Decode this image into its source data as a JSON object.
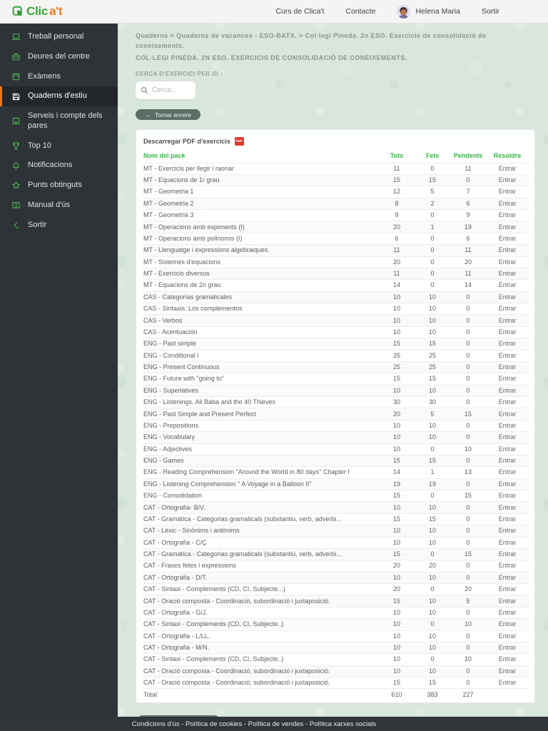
{
  "colors": {
    "accent_green": "#3cb54a",
    "logo_orange": "#f07c1d",
    "active_orange": "#ec7214",
    "sidebar_bg": "#2e3338",
    "content_bg": "#d9e6db",
    "footer_bg": "#30353a",
    "pdf_red": "#e0392e"
  },
  "navbar": {
    "logo_green": "Clic",
    "logo_orange_text": "a't",
    "logo_icon": "cursor-icon",
    "links": [
      {
        "label": "Curs de Clica't"
      },
      {
        "label": "Contacte"
      }
    ],
    "user_name": "Helena Maria",
    "logout_label": "Sortir"
  },
  "sidebar": {
    "items": [
      {
        "label": "Treball personal",
        "icon": "laptop-icon"
      },
      {
        "label": "Deures del centre",
        "icon": "briefcase-icon"
      },
      {
        "label": "Exàmens",
        "icon": "calendar-icon"
      },
      {
        "label": "Quaderns d'estiu",
        "icon": "save-icon",
        "active": true
      },
      {
        "label": "Serveis i compte dels pares",
        "icon": "store-icon"
      },
      {
        "label": "Top 10",
        "icon": "trophy-icon"
      },
      {
        "label": "Notificacions",
        "icon": "bell-icon"
      },
      {
        "label": "Punts obtinguts",
        "icon": "star-icon"
      },
      {
        "label": "Manual d'ús",
        "icon": "book-icon"
      },
      {
        "label": "Sortir",
        "icon": "exit-icon"
      }
    ]
  },
  "main": {
    "breadcrumb": "Quaderns > Quaderns de vacances - ESO-BATX. > Col·legi Pineda. 2n ESO. Exercicis de consolidació de coneixements.",
    "title": "COL·LEGI PINEDA. 2N ESO. EXERCICIS DE CONSOLIDACIÓ DE CONEIXEMENTS.",
    "search_label": "CERCA D'EXERCICI PER ID :",
    "search_placeholder": "Cerca...",
    "search_icon": "search-icon",
    "back_button": "Tornar enrere",
    "back_arrow_icon": "arrow-left-icon",
    "card": {
      "download_pdf": "Descarregar PDF d'exercicis",
      "pdf_icon_text": "PDF",
      "table": {
        "headers": [
          "Nom del pack",
          "Tots",
          "Fets",
          "Pendents",
          "Resoldre"
        ],
        "action_label": "Entrar",
        "rows": [
          {
            "name": "MT - Exercicis per llegir i raonar",
            "tots": 11,
            "fets": 0,
            "pendents": 11
          },
          {
            "name": "MT - Equacions de 1r grau",
            "tots": 15,
            "fets": 15,
            "pendents": 0
          },
          {
            "name": "MT - Geometria 1",
            "tots": 12,
            "fets": 5,
            "pendents": 7
          },
          {
            "name": "MT - Geometria 2",
            "tots": 8,
            "fets": 2,
            "pendents": 6
          },
          {
            "name": "MT - Geometria 3",
            "tots": 9,
            "fets": 0,
            "pendents": 9
          },
          {
            "name": "MT - Operacions amb exponents (I)",
            "tots": 20,
            "fets": 1,
            "pendents": 19
          },
          {
            "name": "MT - Operacions amb polinomis (I)",
            "tots": 6,
            "fets": 0,
            "pendents": 6
          },
          {
            "name": "MT - Llenguatge i expressions algebraiques.",
            "tots": 11,
            "fets": 0,
            "pendents": 11
          },
          {
            "name": "MT - Sistemes d'equacions",
            "tots": 20,
            "fets": 0,
            "pendents": 20
          },
          {
            "name": "MT - Exercicis diversos",
            "tots": 11,
            "fets": 0,
            "pendents": 11
          },
          {
            "name": "MT - Equacions de 2n grau",
            "tots": 14,
            "fets": 0,
            "pendents": 14
          },
          {
            "name": "CAS - Categorías gramaticales",
            "tots": 10,
            "fets": 10,
            "pendents": 0
          },
          {
            "name": "CAS - Sintaxis: Los complementos",
            "tots": 10,
            "fets": 10,
            "pendents": 0
          },
          {
            "name": "CAS - Verbos",
            "tots": 10,
            "fets": 10,
            "pendents": 0
          },
          {
            "name": "CAS - Acentuación",
            "tots": 10,
            "fets": 10,
            "pendents": 0
          },
          {
            "name": "ENG - Past simple",
            "tots": 15,
            "fets": 15,
            "pendents": 0
          },
          {
            "name": "ENG - Conditional I",
            "tots": 25,
            "fets": 25,
            "pendents": 0
          },
          {
            "name": "ENG - Present Continuous",
            "tots": 25,
            "fets": 25,
            "pendents": 0
          },
          {
            "name": "ENG - Future with \"going to\"",
            "tots": 15,
            "fets": 15,
            "pendents": 0
          },
          {
            "name": "ENG - Superlatives",
            "tots": 10,
            "fets": 10,
            "pendents": 0
          },
          {
            "name": "ENG - Listenings. Ali Baba and the 40 Thieves",
            "tots": 30,
            "fets": 30,
            "pendents": 0
          },
          {
            "name": "ENG - Past Simple and Present Perfect",
            "tots": 20,
            "fets": 5,
            "pendents": 15
          },
          {
            "name": "ENG - Prepositions",
            "tots": 10,
            "fets": 10,
            "pendents": 0
          },
          {
            "name": "ENG - Vocabulary",
            "tots": 10,
            "fets": 10,
            "pendents": 0
          },
          {
            "name": "ENG - Adjectives",
            "tots": 10,
            "fets": 0,
            "pendents": 10
          },
          {
            "name": "ENG - Games",
            "tots": 15,
            "fets": 15,
            "pendents": 0
          },
          {
            "name": "ENG - Reading Comprehension \"Around the World in 80 days\" Chapter I",
            "tots": 14,
            "fets": 1,
            "pendents": 13
          },
          {
            "name": "ENG - Listening Comprehension \" A Voyage in a Balloon II\"",
            "tots": 19,
            "fets": 19,
            "pendents": 0
          },
          {
            "name": "ENG - Consolidation",
            "tots": 15,
            "fets": 0,
            "pendents": 15
          },
          {
            "name": "CAT - Ortografia- B/V.",
            "tots": 10,
            "fets": 10,
            "pendents": 0
          },
          {
            "name": "CAT - Gramàtica - Categorias gramaticals (substantiu, verb, adverbi...",
            "tots": 15,
            "fets": 15,
            "pendents": 0
          },
          {
            "name": "CAT - Lèxic - Sinònims i antònims",
            "tots": 10,
            "fets": 10,
            "pendents": 0
          },
          {
            "name": "CAT - Ortografia - C/Ç",
            "tots": 10,
            "fets": 10,
            "pendents": 0
          },
          {
            "name": "CAT - Gramàtica - Categorias gramaticals (substantiu, verb, adverbi...",
            "tots": 15,
            "fets": 0,
            "pendents": 15
          },
          {
            "name": "CAT - Frases fetes i expressions",
            "tots": 20,
            "fets": 20,
            "pendents": 0
          },
          {
            "name": "CAT - Ortografia - D/T.",
            "tots": 10,
            "fets": 10,
            "pendents": 0
          },
          {
            "name": "CAT - Sintaxi - Complements (CD, CI, Subjecte...)",
            "tots": 20,
            "fets": 0,
            "pendents": 20
          },
          {
            "name": "CAT - Oració composta - Coordinació, subordinació i juxtaposició.",
            "tots": 15,
            "fets": 10,
            "pendents": 5
          },
          {
            "name": "CAT - Ortografia - G/J.",
            "tots": 10,
            "fets": 10,
            "pendents": 0
          },
          {
            "name": "CAT - Sintaxi - Complements (CD, CI, Subjecte..)",
            "tots": 10,
            "fets": 0,
            "pendents": 10
          },
          {
            "name": "CAT - Ortografia - L/LL.",
            "tots": 10,
            "fets": 10,
            "pendents": 0
          },
          {
            "name": "CAT - Ortografia - M/N.",
            "tots": 10,
            "fets": 10,
            "pendents": 0
          },
          {
            "name": "CAT - Sintaxi - Complements (CD, CI, Subjecte..)",
            "tots": 10,
            "fets": 0,
            "pendents": 10
          },
          {
            "name": "CAT - Oració composta - Coordinació, subordinació i juxtaposició.",
            "tots": 10,
            "fets": 10,
            "pendents": 0
          },
          {
            "name": "CAT - Oració composta - Coordinació, subordinació i juxtaposició.",
            "tots": 15,
            "fets": 15,
            "pendents": 0
          }
        ],
        "total": {
          "label": "Total",
          "tots": 610,
          "fets": 383,
          "pendents": 227
        }
      }
    }
  },
  "footer": {
    "text": "Condicions d'ús - Política de cookies - Política de vendes - Política xarxes socials"
  }
}
